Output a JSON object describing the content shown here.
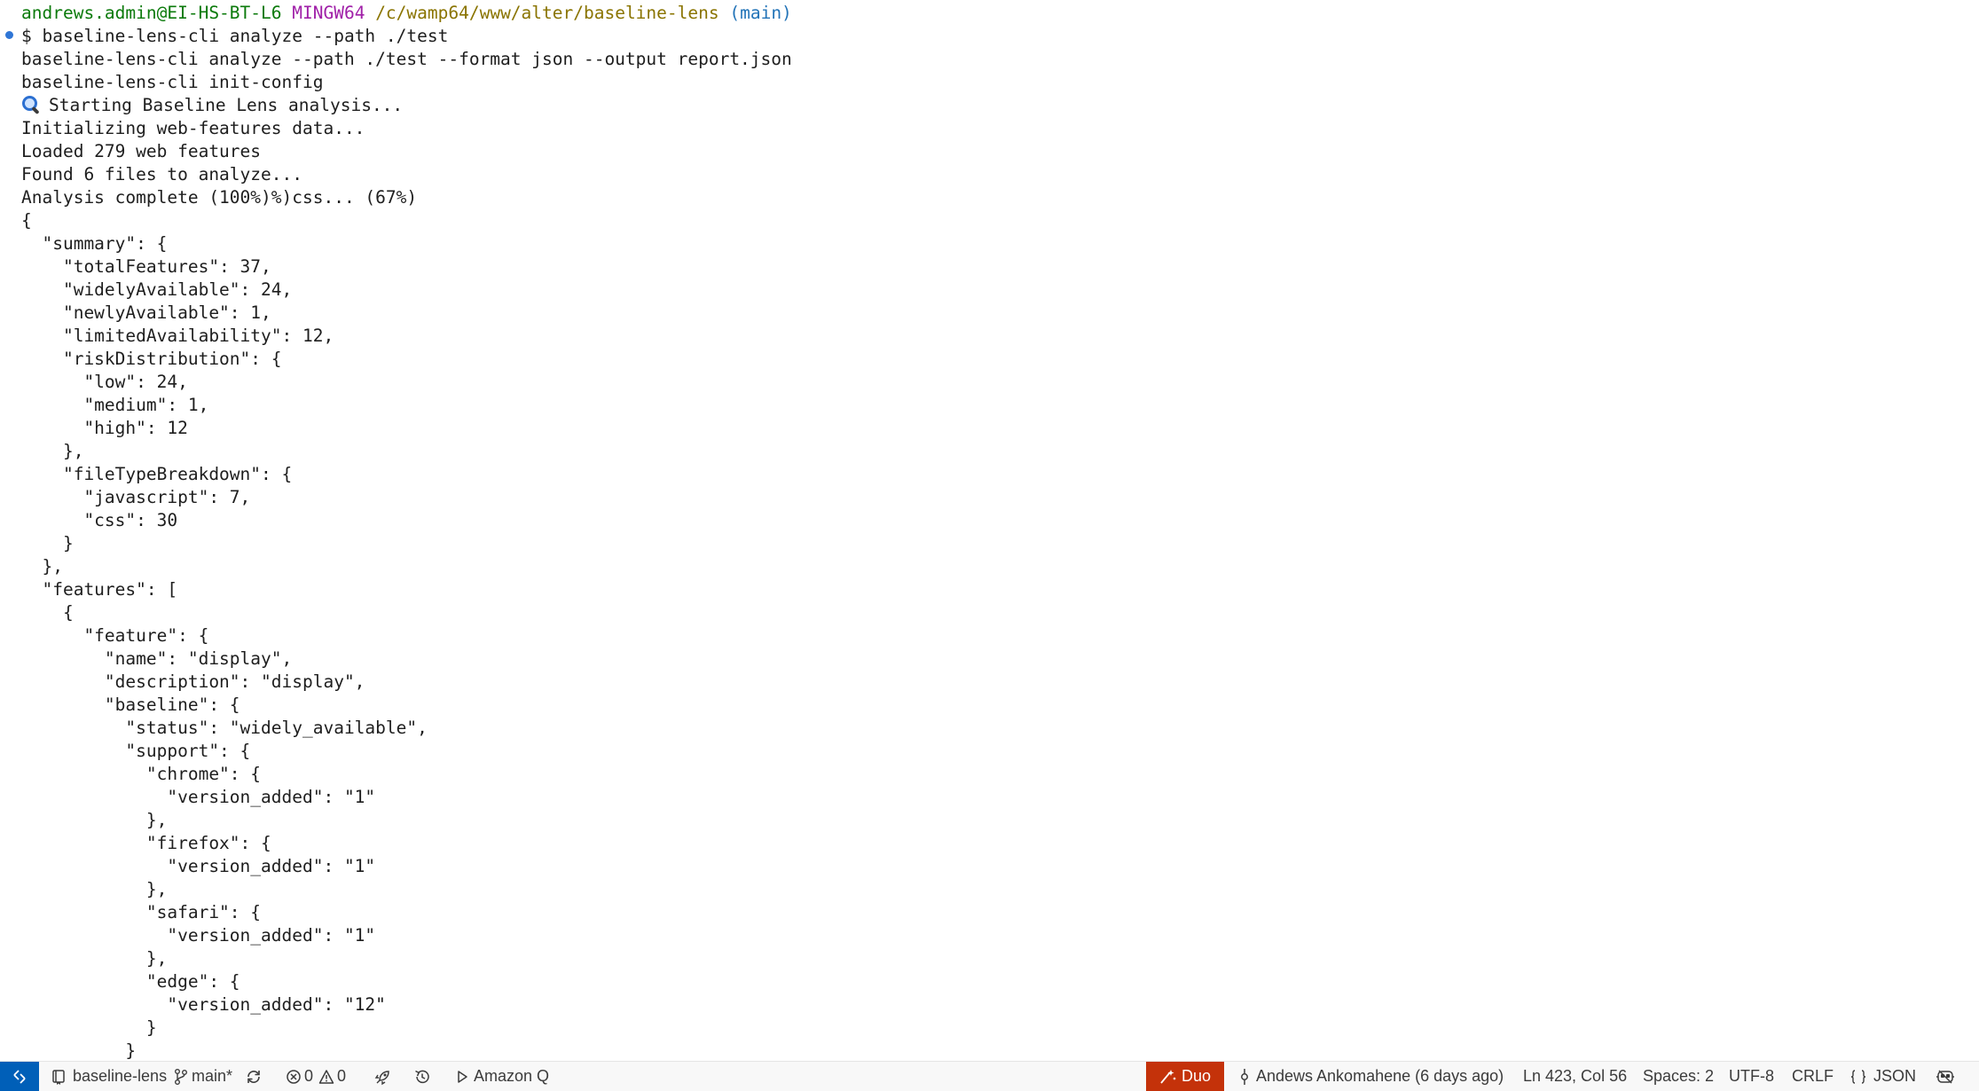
{
  "terminal": {
    "prompt": {
      "user_host": "andrews.admin@EI-HS-BT-L6",
      "system": "MINGW64",
      "path": "/c/wamp64/www/alter/baseline-lens",
      "branch": "(main)"
    },
    "lines": [
      "$ baseline-lens-cli analyze --path ./test",
      "baseline-lens-cli analyze --path ./test --format json --output report.json",
      "baseline-lens-cli init-config",
      "Starting Baseline Lens analysis...",
      "Initializing web-features data...",
      "Loaded 279 web features",
      "Found 6 files to analyze...",
      "Analysis complete (100%)%)css... (67%)",
      "{",
      "  \"summary\": {",
      "    \"totalFeatures\": 37,",
      "    \"widelyAvailable\": 24,",
      "    \"newlyAvailable\": 1,",
      "    \"limitedAvailability\": 12,",
      "    \"riskDistribution\": {",
      "      \"low\": 24,",
      "      \"medium\": 1,",
      "      \"high\": 12",
      "    },",
      "    \"fileTypeBreakdown\": {",
      "      \"javascript\": 7,",
      "      \"css\": 30",
      "    }",
      "  },",
      "  \"features\": [",
      "    {",
      "      \"feature\": {",
      "        \"name\": \"display\",",
      "        \"description\": \"display\",",
      "        \"baseline\": {",
      "          \"status\": \"widely_available\",",
      "          \"support\": {",
      "            \"chrome\": {",
      "              \"version_added\": \"1\"",
      "            },",
      "            \"firefox\": {",
      "              \"version_added\": \"1\"",
      "            },",
      "            \"safari\": {",
      "              \"version_added\": \"1\"",
      "            },",
      "            \"edge\": {",
      "              \"version_added\": \"12\"",
      "            }",
      "          }"
    ]
  },
  "statusbar": {
    "repo": "baseline-lens",
    "branch": "main*",
    "errors": "0",
    "warnings": "0",
    "amazon_q": "Amazon Q",
    "duo": "Duo",
    "blame": "Andews Ankomahene (6 days ago)",
    "cursor": "Ln 423, Col 56",
    "spaces": "Spaces: 2",
    "encoding": "UTF-8",
    "eol": "CRLF",
    "language": "JSON"
  },
  "colors": {
    "remote_bg": "#005fb8",
    "duo_bg": "#c4320a",
    "prompt_user": "#0b7a0b",
    "prompt_system": "#a020a8",
    "prompt_path": "#8a7400",
    "prompt_branch": "#2374b8"
  },
  "icons": {
    "remote": "remote-icon",
    "repo": "repo-icon",
    "branch": "git-branch-icon",
    "sync": "sync-icon",
    "error": "error-icon",
    "warning": "warning-icon",
    "rocket": "rocket-icon",
    "history": "history-icon",
    "play": "play-icon",
    "duo": "duo-icon",
    "commit": "git-commit-icon",
    "braces": "braces-icon",
    "copilot": "copilot-icon",
    "magnifier": "magnifying-glass-icon"
  }
}
